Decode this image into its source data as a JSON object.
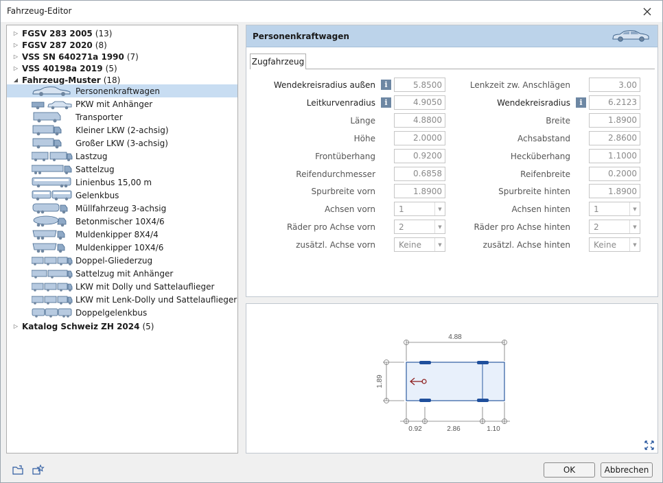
{
  "window": {
    "title": "Fahrzeug-Editor"
  },
  "tree": {
    "groups_top": [
      {
        "label": "FGSV 283 2005",
        "count": "(13)"
      },
      {
        "label": "FGSV 287 2020",
        "count": "(8)"
      },
      {
        "label": "VSS SN 640271a 1990",
        "count": "(7)"
      },
      {
        "label": "VSS 40198a 2019",
        "count": "(5)"
      }
    ],
    "open_group": {
      "label": "Fahrzeug-Muster",
      "count": "(18)"
    },
    "vehicles": [
      {
        "label": "Personenkraftwagen",
        "icon": "car-icon"
      },
      {
        "label": "PKW mit Anhänger",
        "icon": "car-trailer-icon"
      },
      {
        "label": "Transporter",
        "icon": "van-icon"
      },
      {
        "label": "Kleiner LKW (2-achsig)",
        "icon": "truck-icon"
      },
      {
        "label": "Großer LKW (3-achsig)",
        "icon": "truck-icon"
      },
      {
        "label": "Lastzug",
        "icon": "truck-trailer-icon"
      },
      {
        "label": "Sattelzug",
        "icon": "semi-truck-icon"
      },
      {
        "label": "Linienbus 15,00 m",
        "icon": "bus-icon"
      },
      {
        "label": "Gelenkbus",
        "icon": "articulated-bus-icon"
      },
      {
        "label": "Müllfahrzeug 3-achsig",
        "icon": "garbage-truck-icon"
      },
      {
        "label": "Betonmischer 10X4/6",
        "icon": "mixer-truck-icon"
      },
      {
        "label": "Muldenkipper 8X4/4",
        "icon": "dump-truck-icon"
      },
      {
        "label": "Muldenkipper 10X4/6",
        "icon": "dump-truck-icon"
      },
      {
        "label": "Doppel-Gliederzug",
        "icon": "road-train-icon"
      },
      {
        "label": "Sattelzug  mit Anhänger",
        "icon": "semi-trailer-icon"
      },
      {
        "label": "LKW mit Dolly und Sattelauflieger",
        "icon": "road-train-icon"
      },
      {
        "label": "LKW mit Lenk-Dolly und Sattelauflieger",
        "icon": "road-train-icon"
      },
      {
        "label": "Doppelgelenkbus",
        "icon": "double-articulated-bus-icon"
      }
    ],
    "groups_bottom": [
      {
        "label": "Katalog Schweiz ZH 2024",
        "count": "(5)"
      }
    ]
  },
  "panel": {
    "title": "Personenkraftwagen",
    "tab": "Zugfahrzeug"
  },
  "fields_left": [
    {
      "label": "Wendekreisradius außen",
      "value": "5.8500",
      "info": true,
      "type": "num"
    },
    {
      "label": "Leitkurvenradius",
      "value": "4.9050",
      "info": true,
      "type": "num"
    },
    {
      "label": "Länge",
      "value": "4.8800",
      "type": "num"
    },
    {
      "label": "Höhe",
      "value": "2.0000",
      "type": "num"
    },
    {
      "label": "Frontüberhang",
      "value": "0.9200",
      "type": "num"
    },
    {
      "label": "Reifendurchmesser",
      "value": "0.6858",
      "type": "num"
    },
    {
      "label": "Spurbreite vorn",
      "value": "1.8900",
      "type": "num"
    },
    {
      "label": "Achsen vorn",
      "value": "1",
      "type": "dd"
    },
    {
      "label": "Räder pro Achse vorn",
      "value": "2",
      "type": "dd"
    },
    {
      "label": "zusätzl. Achse vorn",
      "value": "Keine",
      "type": "dd"
    }
  ],
  "fields_right": [
    {
      "label": "Lenkzeit zw. Anschlägen",
      "value": "3.00",
      "type": "num"
    },
    {
      "label": "Wendekreisradius",
      "value": "6.2123",
      "info": true,
      "type": "num"
    },
    {
      "label": "Breite",
      "value": "1.8900",
      "type": "num"
    },
    {
      "label": "Achsabstand",
      "value": "2.8600",
      "type": "num"
    },
    {
      "label": "Hecküberhang",
      "value": "1.1000",
      "type": "num"
    },
    {
      "label": "Reifenbreite",
      "value": "0.2000",
      "type": "num"
    },
    {
      "label": "Spurbreite hinten",
      "value": "1.8900",
      "type": "num"
    },
    {
      "label": "Achsen hinten",
      "value": "1",
      "type": "dd"
    },
    {
      "label": "Räder pro Achse hinten",
      "value": "2",
      "type": "dd"
    },
    {
      "label": "zusätzl. Achse hinten",
      "value": "Keine",
      "type": "dd"
    }
  ],
  "info_glyph": "i",
  "preview": {
    "length": "4.88",
    "width": "1.89",
    "front_overhang": "0.92",
    "wheelbase": "2.86",
    "rear_overhang": "1.10"
  },
  "buttons": {
    "ok": "OK",
    "cancel": "Abbrechen"
  },
  "colors": {
    "selection": "#c8ddf2",
    "header": "#bcd3ea",
    "vehicle_fill": "#e8f0fb",
    "vehicle_stroke": "#2c5aa0",
    "wheel": "#1f4f9c",
    "arrow": "#8b1a1a"
  }
}
